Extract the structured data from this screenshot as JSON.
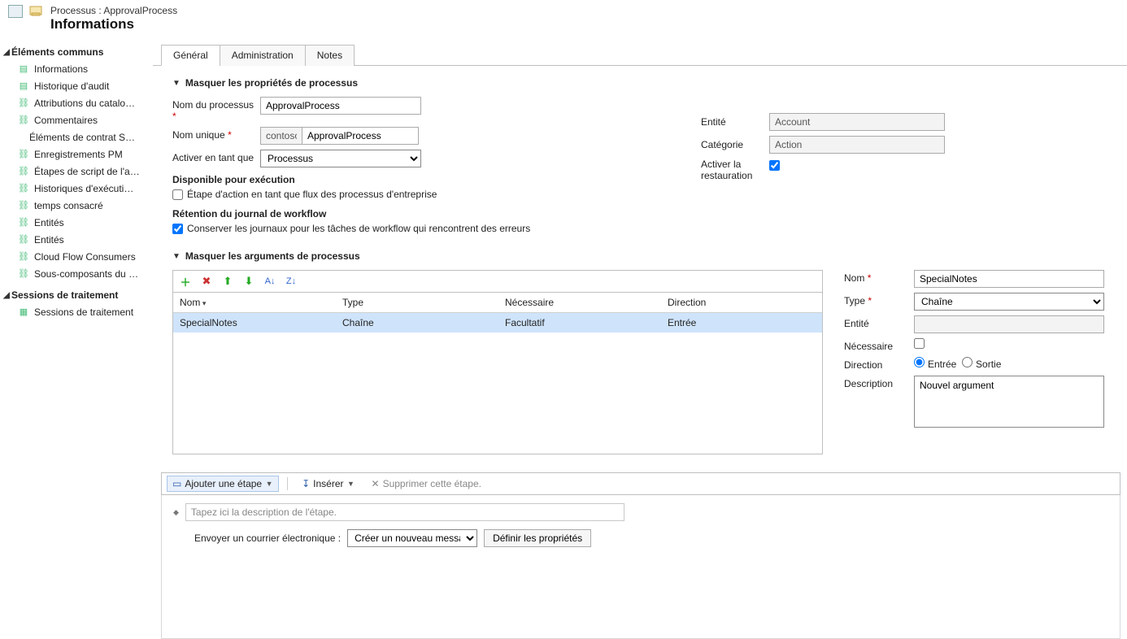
{
  "header": {
    "crumb": "Processus : ApprovalProcess",
    "title": "Informations"
  },
  "sidebar": {
    "section1_title": "Éléments communs",
    "items": [
      "Informations",
      "Historique d'audit",
      "Attributions du catalo…",
      "Commentaires",
      "Éléments de contrat S…",
      "Enregistrements PM",
      "Étapes de script de l'a…",
      "Historiques d'exécuti…",
      "temps consacré",
      "Entités",
      "Entités",
      "Cloud Flow Consumers",
      "Sous-composants du …"
    ],
    "section2_title": "Sessions de traitement",
    "items2": [
      "Sessions de traitement"
    ]
  },
  "tabs": {
    "t1": "Général",
    "t2": "Administration",
    "t3": "Notes"
  },
  "sections": {
    "props": "Masquer les propriétés de processus",
    "args": "Masquer les arguments de processus"
  },
  "form": {
    "process_name_label": "Nom du processus",
    "process_name_value": "ApprovalProcess",
    "unique_name_label": "Nom unique",
    "unique_prefix": "contoso_",
    "unique_value": "ApprovalProcess",
    "activate_as_label": "Activer en tant que",
    "activate_as_value": "Processus",
    "avail_title": "Disponible pour exécution",
    "avail_chk_label": "Étape d'action en tant que flux des processus d'entreprise",
    "retention_title": "Rétention du journal de workflow",
    "retention_chk_label": "Conserver les journaux pour les tâches de workflow qui rencontrent des erreurs"
  },
  "right_props": {
    "entity_label": "Entité",
    "entity_value": "Account",
    "category_label": "Catégorie",
    "category_value": "Action",
    "restore_label1": "Activer la",
    "restore_label2": "restauration"
  },
  "grid": {
    "cols": {
      "name": "Nom",
      "type": "Type",
      "req": "Nécessaire",
      "dir": "Direction"
    },
    "rows": [
      {
        "name": "SpecialNotes",
        "type": "Chaîne",
        "req": "Facultatif",
        "dir": "Entrée"
      }
    ]
  },
  "arg_props": {
    "name_label": "Nom",
    "name_value": "SpecialNotes",
    "type_label": "Type",
    "type_value": "Chaîne",
    "entity_label": "Entité",
    "req_label": "Nécessaire",
    "dir_label": "Direction",
    "dir_in": "Entrée",
    "dir_out": "Sortie",
    "desc_label": "Description",
    "desc_value": "Nouvel argument"
  },
  "stepbar": {
    "add": "Ajouter une étape",
    "insert": "Insérer",
    "delete": "Supprimer cette étape."
  },
  "stepbody": {
    "desc_placeholder": "Tapez ici la description de l'étape.",
    "send_email_label": "Envoyer un courrier électronique :",
    "send_email_value": "Créer un nouveau message",
    "define_props": "Définir les propriétés"
  }
}
